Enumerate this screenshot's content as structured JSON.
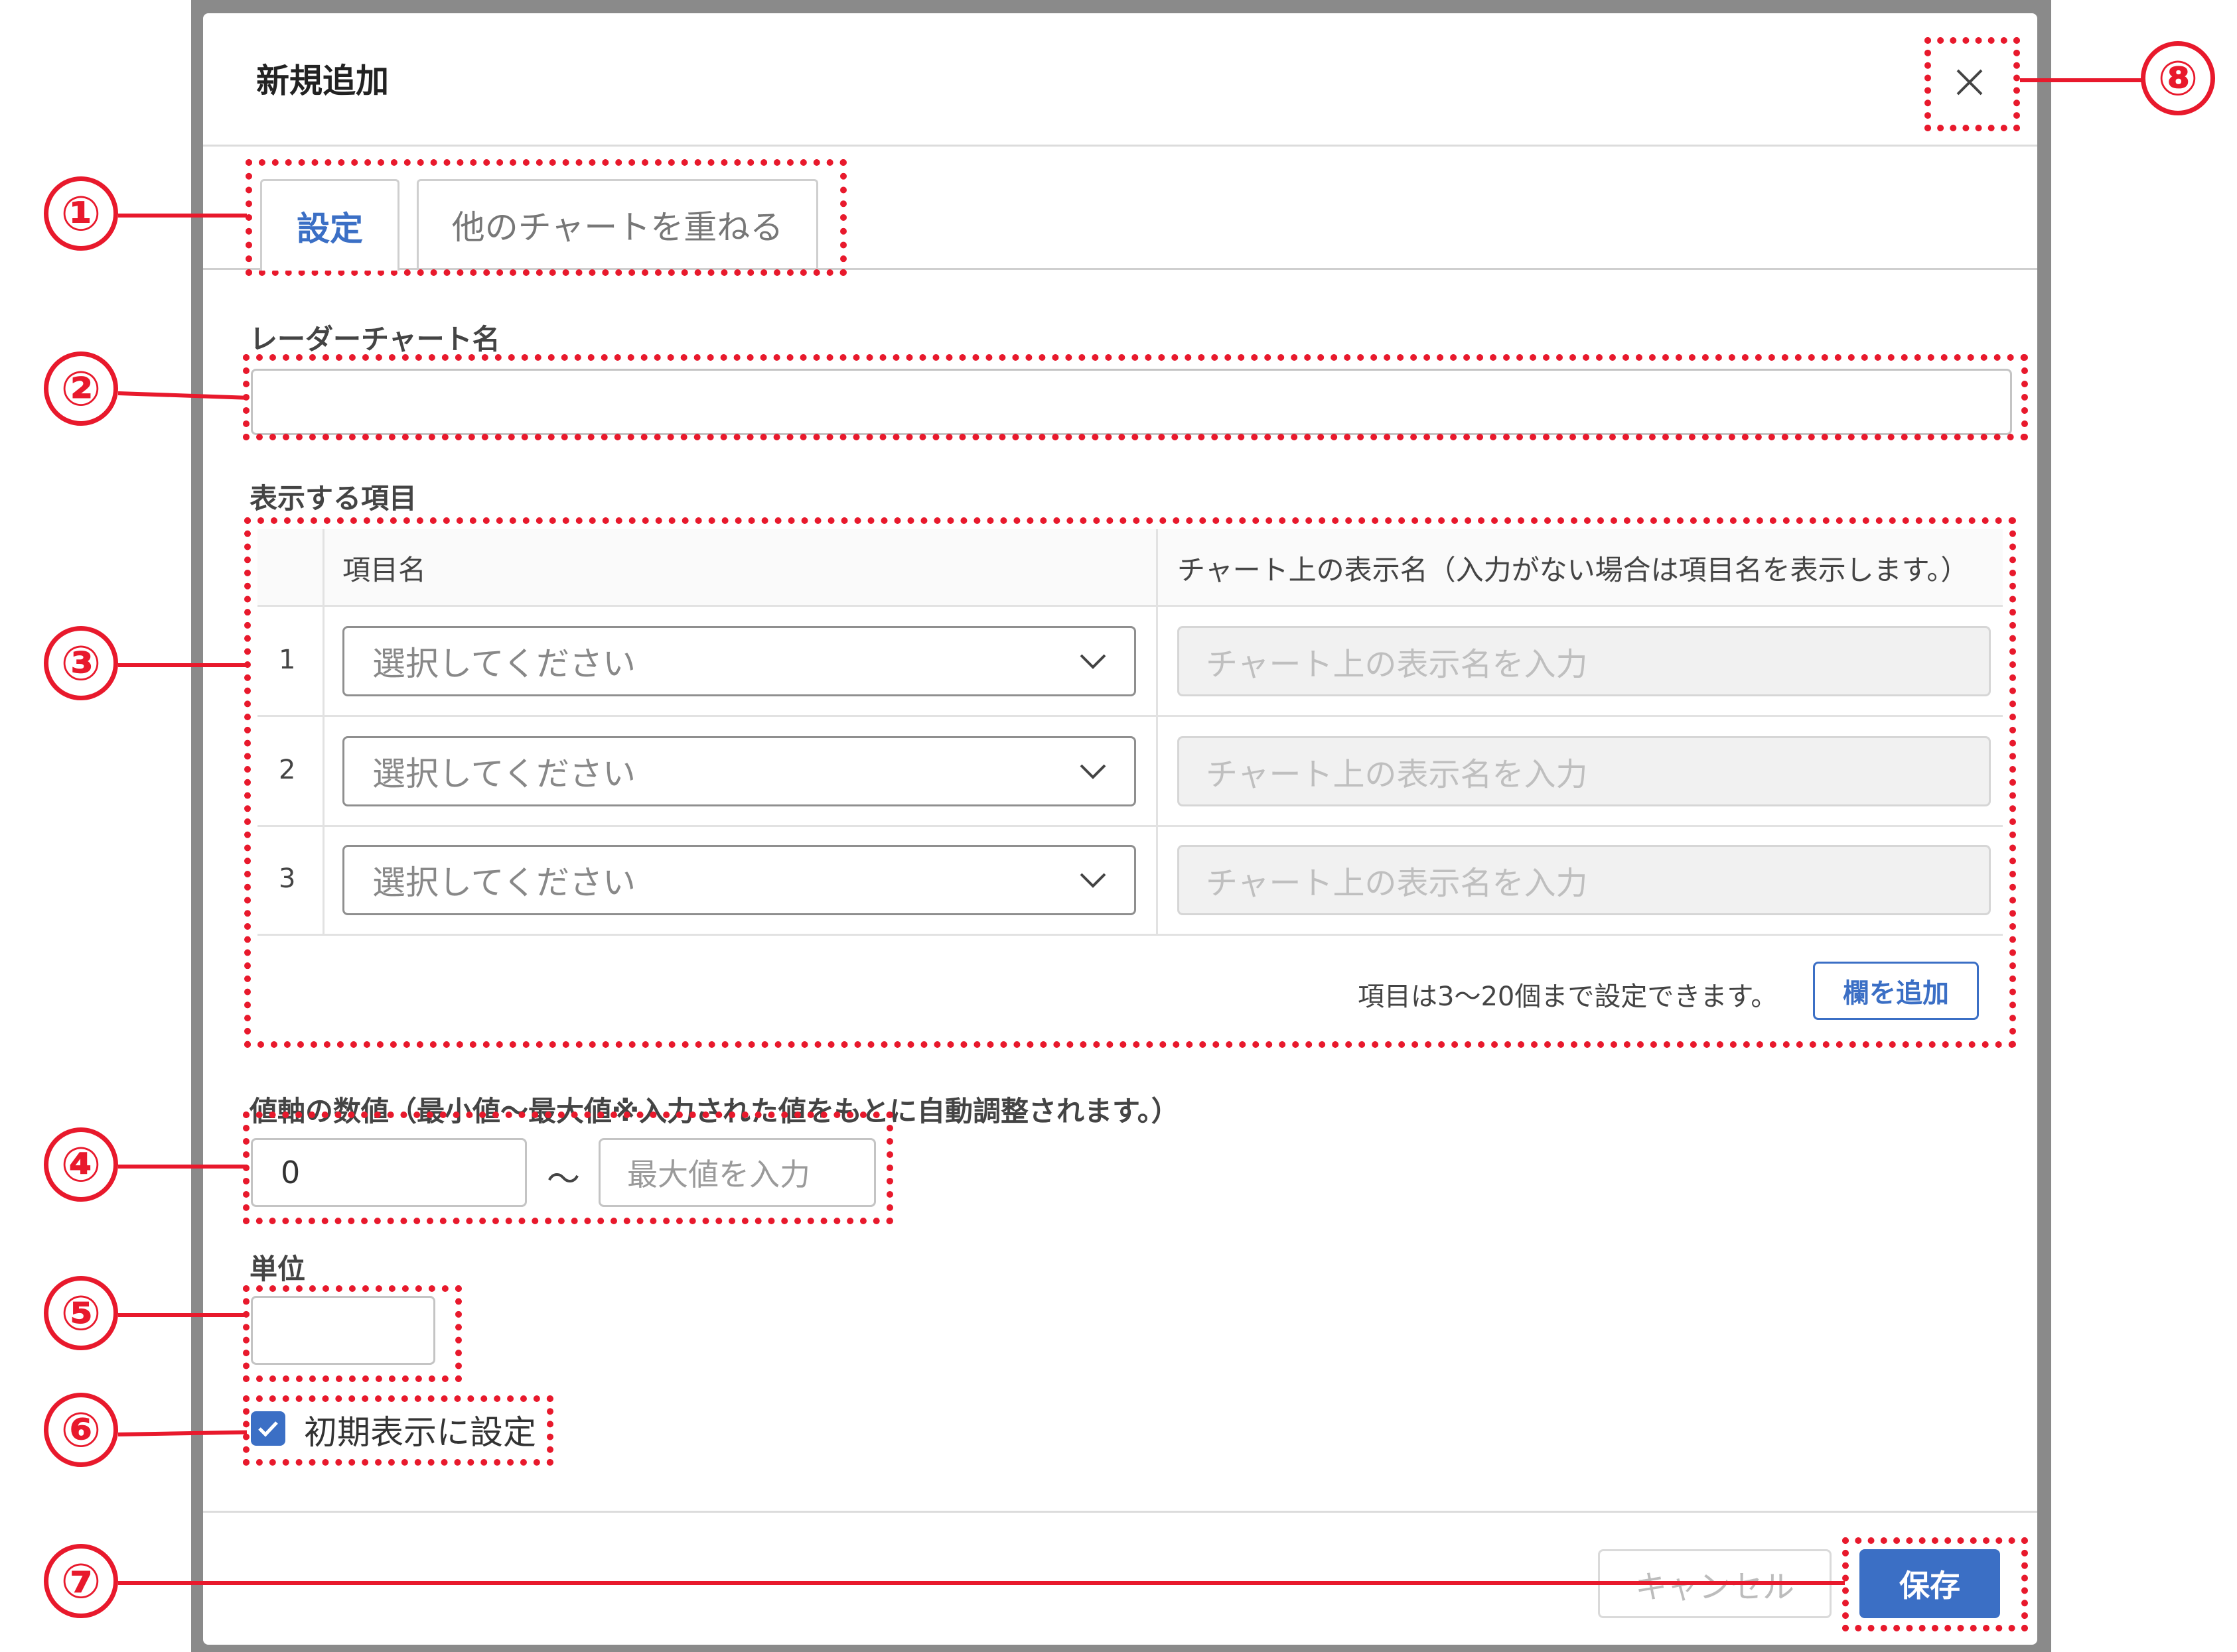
{
  "dialog": {
    "title": "新規追加",
    "close_icon": "close-icon"
  },
  "tabs": [
    {
      "label": "設定",
      "active": true
    },
    {
      "label": "他のチャートを重ねる",
      "active": false
    }
  ],
  "chart_name": {
    "label": "レーダーチャート名",
    "value": ""
  },
  "items": {
    "label": "表示する項目",
    "columns": [
      "項目名",
      "チャート上の表示名（入力がない場合は項目名を表示します。）"
    ],
    "rows": [
      {
        "num": "1",
        "select_placeholder": "選択してください",
        "display_placeholder": "チャート上の表示名を入力"
      },
      {
        "num": "2",
        "select_placeholder": "選択してください",
        "display_placeholder": "チャート上の表示名を入力"
      },
      {
        "num": "3",
        "select_placeholder": "選択してください",
        "display_placeholder": "チャート上の表示名を入力"
      }
    ],
    "note": "項目は3〜20個まで設定できます。",
    "add_button": "欄を追加"
  },
  "value_axis": {
    "label": "値軸の数値（最小値〜最大値※入力された値をもとに自動調整されます。）",
    "min_value": "0",
    "separator": "〜",
    "max_placeholder": "最大値を入力"
  },
  "unit": {
    "label": "単位",
    "value": ""
  },
  "initial_display": {
    "label": "初期表示に設定",
    "checked": true
  },
  "footer": {
    "cancel": "キャンセル",
    "save": "保存"
  },
  "annotations": [
    "①",
    "②",
    "③",
    "④",
    "⑤",
    "⑥",
    "⑦",
    "⑧"
  ],
  "colors": {
    "accent": "#3b6fc5",
    "annotation": "#e8192c"
  }
}
